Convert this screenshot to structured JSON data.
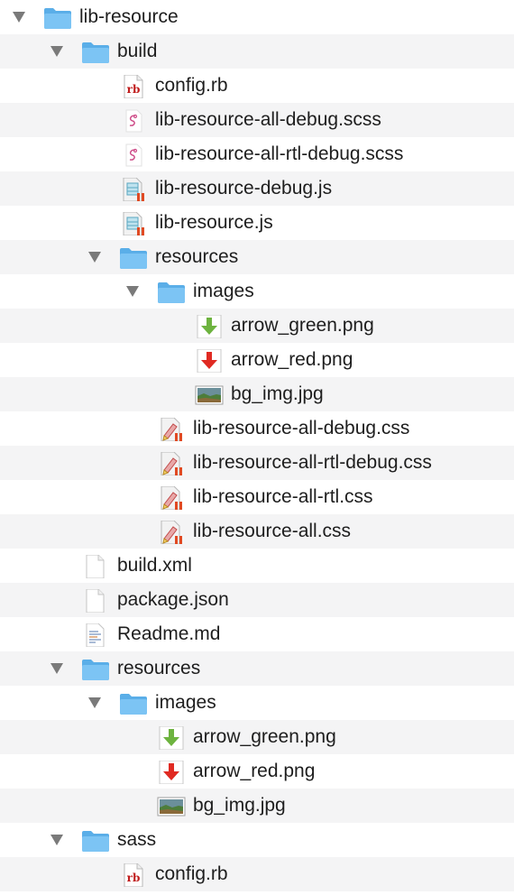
{
  "tree": {
    "items": [
      {
        "label": "lib-resource",
        "depth": 0,
        "type": "folder",
        "expanded": true,
        "icon": "folder-icon"
      },
      {
        "label": "build",
        "depth": 1,
        "type": "folder",
        "expanded": true,
        "icon": "folder-icon"
      },
      {
        "label": "config.rb",
        "depth": 2,
        "type": "file",
        "icon": "ruby-file-icon"
      },
      {
        "label": "lib-resource-all-debug.scss",
        "depth": 2,
        "type": "file",
        "icon": "scss-file-icon"
      },
      {
        "label": "lib-resource-all-rtl-debug.scss",
        "depth": 2,
        "type": "file",
        "icon": "scss-file-icon"
      },
      {
        "label": "lib-resource-debug.js",
        "depth": 2,
        "type": "file",
        "icon": "js-file-icon"
      },
      {
        "label": "lib-resource.js",
        "depth": 2,
        "type": "file",
        "icon": "js-file-icon"
      },
      {
        "label": "resources",
        "depth": 2,
        "type": "folder",
        "expanded": true,
        "icon": "folder-icon"
      },
      {
        "label": "images",
        "depth": 3,
        "type": "folder",
        "expanded": true,
        "icon": "folder-icon"
      },
      {
        "label": "arrow_green.png",
        "depth": 4,
        "type": "file",
        "icon": "green-arrow-image-icon"
      },
      {
        "label": "arrow_red.png",
        "depth": 4,
        "type": "file",
        "icon": "red-arrow-image-icon"
      },
      {
        "label": "bg_img.jpg",
        "depth": 4,
        "type": "file",
        "icon": "photo-image-icon"
      },
      {
        "label": "lib-resource-all-debug.css",
        "depth": 3,
        "type": "file",
        "icon": "css-file-icon"
      },
      {
        "label": "lib-resource-all-rtl-debug.css",
        "depth": 3,
        "type": "file",
        "icon": "css-file-icon"
      },
      {
        "label": "lib-resource-all-rtl.css",
        "depth": 3,
        "type": "file",
        "icon": "css-file-icon"
      },
      {
        "label": "lib-resource-all.css",
        "depth": 3,
        "type": "file",
        "icon": "css-file-icon"
      },
      {
        "label": "build.xml",
        "depth": 1,
        "type": "file",
        "icon": "blank-file-icon"
      },
      {
        "label": "package.json",
        "depth": 1,
        "type": "file",
        "icon": "blank-file-icon"
      },
      {
        "label": "Readme.md",
        "depth": 1,
        "type": "file",
        "icon": "text-file-icon"
      },
      {
        "label": "resources",
        "depth": 1,
        "type": "folder",
        "expanded": true,
        "icon": "folder-icon"
      },
      {
        "label": "images",
        "depth": 2,
        "type": "folder",
        "expanded": true,
        "icon": "folder-icon"
      },
      {
        "label": "arrow_green.png",
        "depth": 3,
        "type": "file",
        "icon": "green-arrow-image-icon"
      },
      {
        "label": "arrow_red.png",
        "depth": 3,
        "type": "file",
        "icon": "red-arrow-image-icon"
      },
      {
        "label": "bg_img.jpg",
        "depth": 3,
        "type": "file",
        "icon": "photo-image-icon"
      },
      {
        "label": "sass",
        "depth": 1,
        "type": "folder",
        "expanded": true,
        "icon": "folder-icon"
      },
      {
        "label": "config.rb",
        "depth": 2,
        "type": "file",
        "icon": "ruby-file-icon"
      }
    ]
  },
  "colors": {
    "folder": "#7cc4f4",
    "folder_tab": "#5aaee8",
    "row_alt": "#f4f4f5",
    "disclosure": "#7a7a7a",
    "text": "#1e1e1e"
  },
  "icon_text": {
    "ruby": "rb"
  }
}
